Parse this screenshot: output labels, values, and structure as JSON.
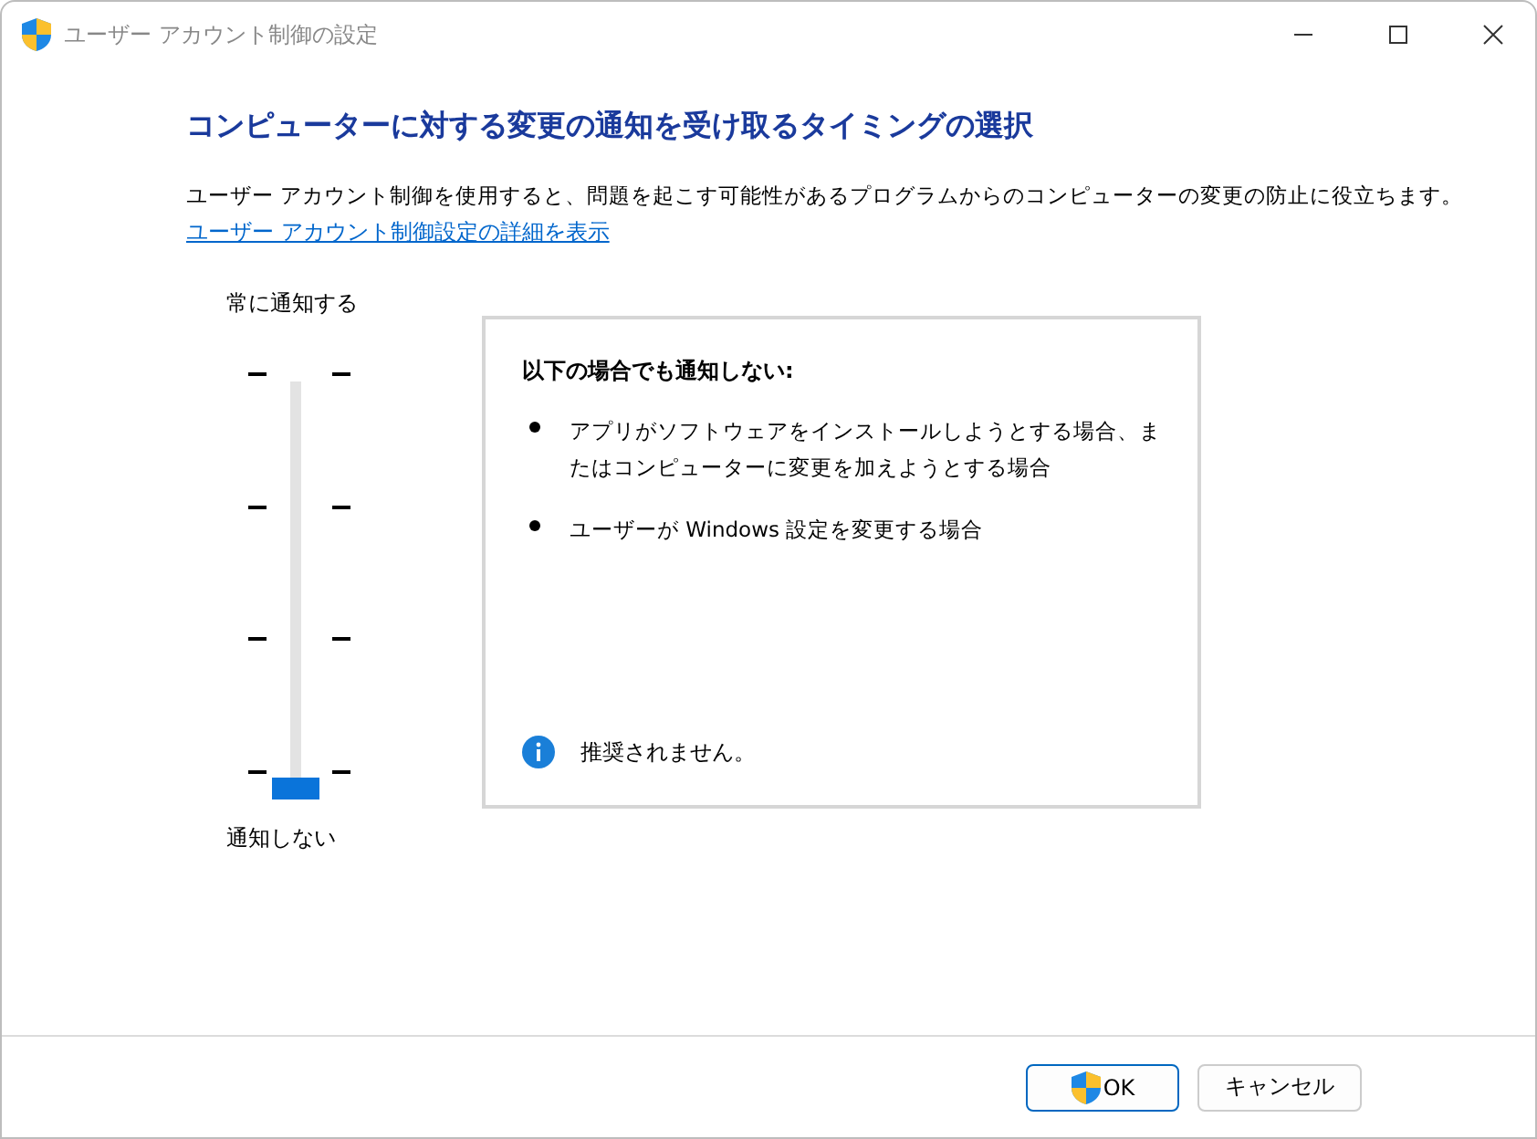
{
  "window": {
    "title": "ユーザー アカウント制御の設定"
  },
  "heading": "コンピューターに対する変更の通知を受け取るタイミングの選択",
  "description": "ユーザー アカウント制御を使用すると、問題を起こす可能性があるプログラムからのコンピューターの変更の防止に役立ちます。",
  "details_link": "ユーザー アカウント制御設定の詳細を表示",
  "slider": {
    "top_label": "常に通知する",
    "bottom_label": "通知しない",
    "level": 0
  },
  "info_panel": {
    "title": "以下の場合でも通知しない:",
    "bullets": [
      "アプリがソフトウェアをインストールしようとする場合、またはコンピューターに変更を加えようとする場合",
      "ユーザーが Windows 設定を変更する場合"
    ],
    "note": "推奨されません。"
  },
  "buttons": [
    {
      "label": "OK",
      "kind": "shield"
    },
    {
      "label": "キャンセル",
      "kind": "plain"
    }
  ]
}
